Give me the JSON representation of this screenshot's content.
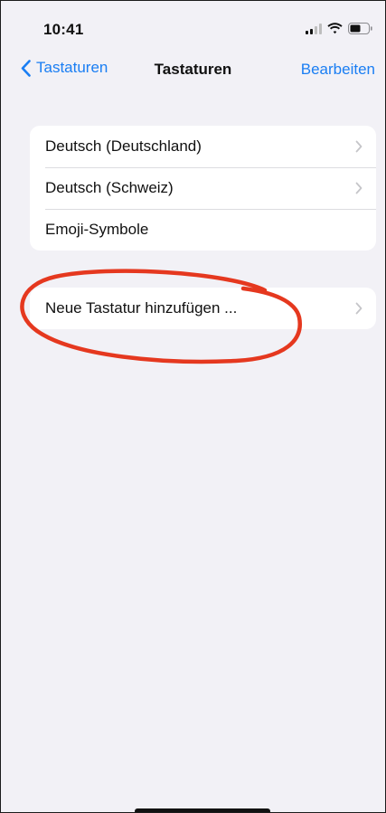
{
  "status_bar": {
    "time": "10:41",
    "icons": [
      "signal-icon",
      "wifi-icon",
      "battery-icon"
    ]
  },
  "nav": {
    "back_label": "Tastaturen",
    "title": "Tastaturen",
    "edit_label": "Bearbeiten"
  },
  "keyboards": [
    {
      "label": "Deutsch (Deutschland)",
      "chevron": true
    },
    {
      "label": "Deutsch (Schweiz)",
      "chevron": true
    },
    {
      "label": "Emoji-Symbole",
      "chevron": false
    }
  ],
  "add_keyboard": {
    "label": "Neue Tastatur hinzufügen ..."
  },
  "colors": {
    "background": "#f2f1f6",
    "accent": "#1a7ef3",
    "annotation": "#e5381f"
  }
}
